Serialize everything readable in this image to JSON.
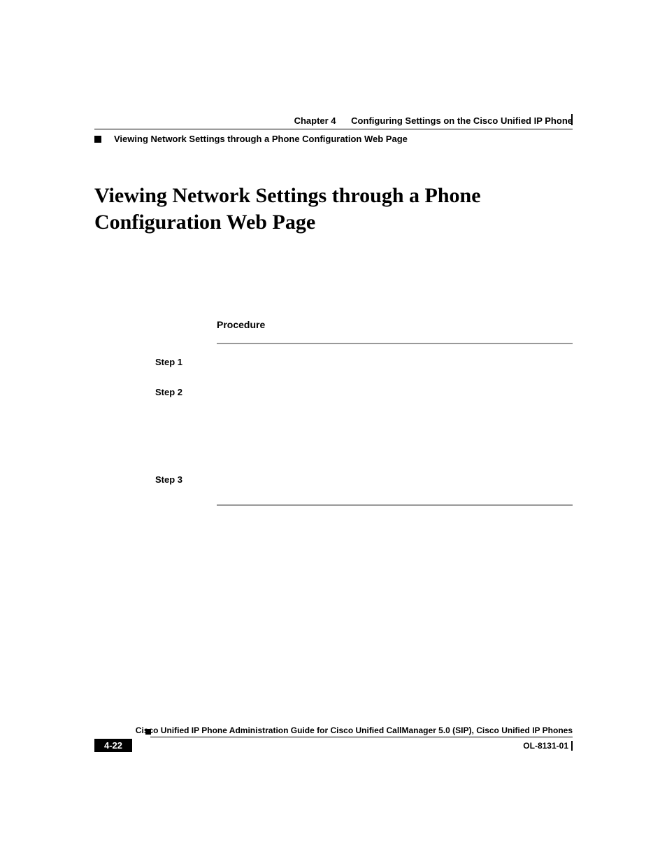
{
  "header": {
    "chapter": "Chapter 4",
    "chapterTitle": "Configuring Settings on the Cisco Unified IP Phone",
    "sectionTitle": "Viewing Network Settings through a Phone Configuration Web Page"
  },
  "heading": "Viewing Network Settings through a Phone Configuration Web Page",
  "procedure": {
    "label": "Procedure",
    "steps": [
      {
        "label": "Step 1"
      },
      {
        "label": "Step 2"
      },
      {
        "label": "Step 3"
      }
    ]
  },
  "footer": {
    "guideTitle": "Cisco Unified IP Phone Administration Guide for Cisco Unified CallManager 5.0 (SIP), Cisco Unified IP Phones",
    "pageNumber": "4-22",
    "docNumber": "OL-8131-01"
  }
}
